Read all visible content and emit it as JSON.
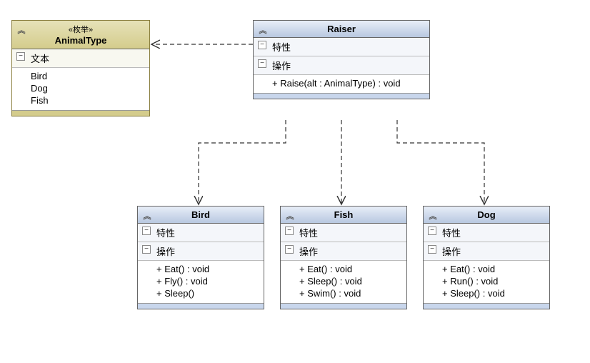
{
  "animalType": {
    "stereotype": "«枚举»",
    "name": "AnimalType",
    "section": "文本",
    "values": [
      "Bird",
      "Dog",
      "Fish"
    ]
  },
  "raiser": {
    "name": "Raiser",
    "attrSection": "特性",
    "opSection": "操作",
    "operations": [
      "+ Raise(alt : AnimalType) : void"
    ]
  },
  "bird": {
    "name": "Bird",
    "attrSection": "特性",
    "opSection": "操作",
    "operations": [
      "+ Eat() : void",
      "+ Fly() : void",
      "+ Sleep()"
    ]
  },
  "fish": {
    "name": "Fish",
    "attrSection": "特性",
    "opSection": "操作",
    "operations": [
      "+ Eat() : void",
      "+ Sleep() : void",
      "+ Swim() : void"
    ]
  },
  "dog": {
    "name": "Dog",
    "attrSection": "特性",
    "opSection": "操作",
    "operations": [
      "+ Eat() : void",
      "+ Run() : void",
      "+ Sleep() : void"
    ]
  }
}
